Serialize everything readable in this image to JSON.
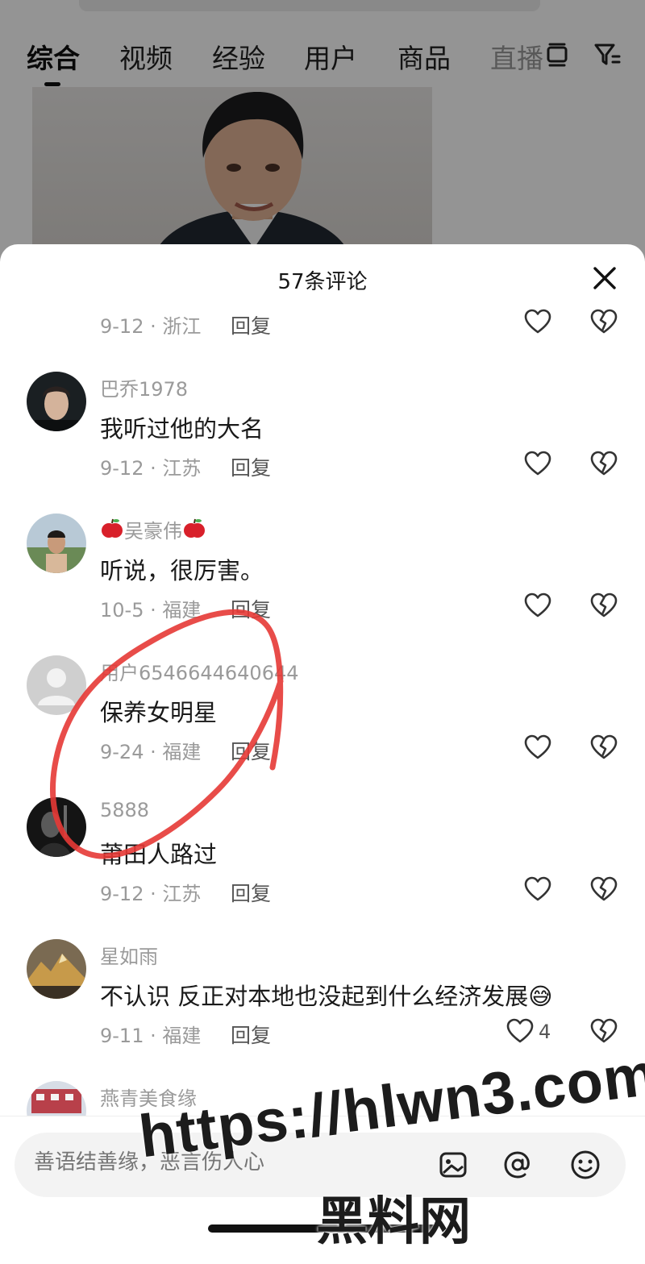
{
  "search_tabs": [
    {
      "label": "综合",
      "active": true
    },
    {
      "label": "视频",
      "active": false
    },
    {
      "label": "经验",
      "active": false
    },
    {
      "label": "用户",
      "active": false
    },
    {
      "label": "商品",
      "active": false
    },
    {
      "label": "直播",
      "active": false
    }
  ],
  "icons": {
    "layout": "layout-toggle-icon",
    "filter": "filter-icon",
    "close": "close-icon",
    "like": "heart-icon",
    "dislike": "broken-heart-icon"
  },
  "sheet": {
    "title": "57条评论"
  },
  "partial_comment": {
    "meta": "9-12 · 浙江",
    "reply": "回复"
  },
  "comments": [
    {
      "username": "巴乔1978",
      "text": "我听过他的大名",
      "meta": "9-12 · 江苏",
      "reply": "回复",
      "likes": ""
    },
    {
      "username": "吴豪伟",
      "text": "听说，很厉害。",
      "meta": "10-5 · 福建",
      "reply": "回复",
      "likes": ""
    },
    {
      "username": "用户6546644640644",
      "text": "保养女明星",
      "meta": "9-24 · 福建",
      "reply": "回复",
      "likes": ""
    },
    {
      "username": "5888",
      "text": "莆田人路过",
      "meta": "9-12 · 江苏",
      "reply": "回复",
      "likes": ""
    },
    {
      "username": "星如雨",
      "text": "不认识 反正对本地也没起到什么经济发展😅",
      "meta": "9-11 · 福建",
      "reply": "回复",
      "likes": "4"
    },
    {
      "username": "燕青美食缘",
      "text": "",
      "meta": "",
      "reply": "",
      "likes": ""
    }
  ],
  "input": {
    "placeholder": "善语结善缘，恶言伤人心"
  },
  "input_icons": [
    "image-icon",
    "at-icon",
    "emoji-icon"
  ],
  "watermark": {
    "url": "https://hlwn3.com",
    "name": "黑料网"
  },
  "colors": {
    "annotation": "#e53935",
    "text_primary": "#1a1a1a",
    "text_secondary": "#9a9a9a"
  }
}
